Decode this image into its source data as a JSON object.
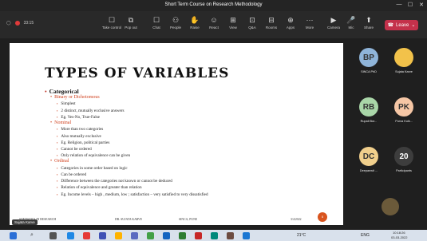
{
  "window": {
    "title": "Short Term Course on Research Methodology",
    "minimize": "—",
    "maximize": "☐",
    "close": "✕"
  },
  "toolbar": {
    "timer": "33:15",
    "items": [
      {
        "label": "Take control",
        "icon": "☐"
      },
      {
        "label": "Pop out",
        "icon": "⧉"
      },
      {
        "label": "Chat",
        "icon": "☐"
      },
      {
        "label": "People",
        "icon": "⚇"
      },
      {
        "label": "Raise",
        "icon": "✋"
      },
      {
        "label": "React",
        "icon": "☺"
      },
      {
        "label": "View",
        "icon": "⊞"
      },
      {
        "label": "Q&A",
        "icon": "⊡"
      },
      {
        "label": "Rooms",
        "icon": "⊟"
      },
      {
        "label": "Apps",
        "icon": "⊕"
      },
      {
        "label": "More",
        "icon": "···"
      },
      {
        "label": "Camera",
        "icon": "▶"
      },
      {
        "label": "Mic",
        "icon": "🎤"
      },
      {
        "label": "Share",
        "icon": "⬆"
      }
    ],
    "leave_label": "Leave"
  },
  "slide": {
    "title": "TYPES OF VARIABLES",
    "lines": [
      {
        "level": 1,
        "text": "Categorical"
      },
      {
        "level": 2,
        "text": "Binary or Dichotomous"
      },
      {
        "level": 3,
        "text": "Simplest"
      },
      {
        "level": 3,
        "text": "2 distinct, mutually exclusive answers"
      },
      {
        "level": 3,
        "text": "Eg. Yes-No, True-False"
      },
      {
        "level": 2,
        "text": "Nominal"
      },
      {
        "level": 3,
        "text": "More than two categories"
      },
      {
        "level": 3,
        "text": "Also mutually exclusive"
      },
      {
        "level": 3,
        "text": "Eg. Religion, political parties"
      },
      {
        "level": 3,
        "text": "Cannot be ordered"
      },
      {
        "level": 3,
        "text": "Only relation of equivalence can be given"
      },
      {
        "level": 2,
        "text": "Ordinal"
      },
      {
        "level": 3,
        "text": "Categories in some order based on logic"
      },
      {
        "level": 3,
        "text": "Can be ordered"
      },
      {
        "level": 3,
        "text": "Difference between the categories not known or cannot be deduced"
      },
      {
        "level": 3,
        "text": "Relation of equivalence and greater than relation"
      },
      {
        "level": 3,
        "text": "Eg. Income levels – high , medium, low ; satisfaction – very satisfied to very dissatisfied"
      }
    ],
    "footer_left": "STATISTICS IN RESEARCH",
    "footer_mid": "DR. SUJATA KARVE",
    "footer_mid2": "SINCA, PUNE",
    "footer_date": "3/4/2022",
    "slide_number": "5"
  },
  "presenter_name": "Sujata Karve",
  "participants": [
    {
      "initials": "BP",
      "name": "SINCA PhD",
      "color": "#8fb4d9"
    },
    {
      "initials": "",
      "name": "Sujata Karve",
      "color": "#f2c24a"
    },
    {
      "initials": "RB",
      "name": "Rupali Bor...",
      "color": "#a9d6a8"
    },
    {
      "initials": "PK",
      "name": "Purva Kulk...",
      "color": "#f5c6a5"
    },
    {
      "initials": "DC",
      "name": "Deepanwit ...",
      "color": "#f0cf8c"
    },
    {
      "initials": "20",
      "name": "Participants",
      "color": "#3d3d3d"
    }
  ],
  "tray": {
    "weather": "21°C",
    "lang": "ENG",
    "time": "10:18:26",
    "date": "03-03-2022"
  }
}
